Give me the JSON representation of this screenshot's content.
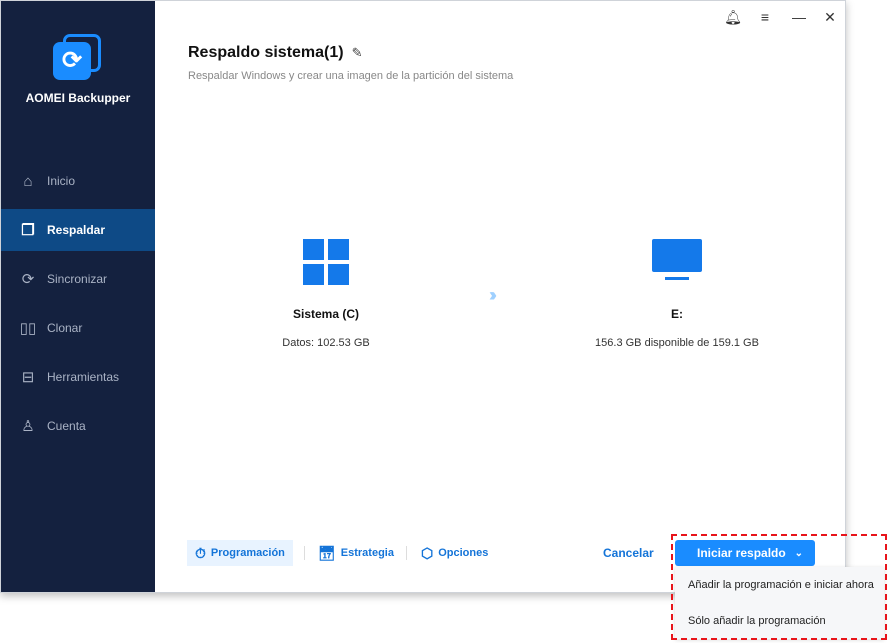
{
  "app": {
    "name": "AOMEI Backupper"
  },
  "sidebar": {
    "items": [
      {
        "label": "Inicio",
        "icon": "home-icon"
      },
      {
        "label": "Respaldar",
        "icon": "backup-icon",
        "active": true
      },
      {
        "label": "Sincronizar",
        "icon": "sync-icon"
      },
      {
        "label": "Clonar",
        "icon": "clone-icon"
      },
      {
        "label": "Herramientas",
        "icon": "toolbox-icon"
      },
      {
        "label": "Cuenta",
        "icon": "user-icon"
      }
    ]
  },
  "header": {
    "title": "Respaldo sistema(1)",
    "subtitle": "Respaldar Windows y crear una imagen de la partición del sistema"
  },
  "source": {
    "label": "Sistema (C)",
    "detail": "Datos: 102.53 GB"
  },
  "destination": {
    "label": "E:",
    "detail": "156.3 GB disponible de 159.1 GB"
  },
  "toolbar": {
    "schedule": "Programación",
    "strategy": "Estrategia",
    "options": "Opciones",
    "cancel": "Cancelar",
    "start": "Iniciar respaldo"
  },
  "dropdown": {
    "items": [
      "Añadir la programación e iniciar ahora",
      "Sólo añadir la programación"
    ]
  },
  "colors": {
    "sidebar": "#14213f",
    "accent": "#1a8cff",
    "highlight": "#e8141b"
  }
}
